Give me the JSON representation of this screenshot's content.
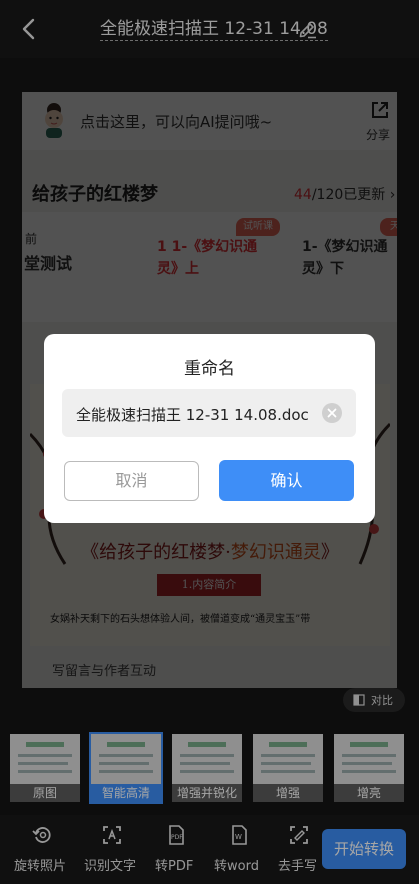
{
  "header": {
    "title": "全能极速扫描王 12-31 14.08"
  },
  "preview": {
    "ask_text": "点击这里，可以向AI提问哦~",
    "share_label": "分享",
    "course_title": "给孩子的红楼梦",
    "progress_current": "44",
    "progress_rest": "/120已更新",
    "lesson_prev_top": "前",
    "lesson_prev": "堂测试",
    "trial_badge": "试听课",
    "lesson_current": "1-《梦幻识通灵》上",
    "lesson_current_prefix": "1",
    "tag_next": "天",
    "lesson_next": "1-《梦幻识通灵》下",
    "poster_title_main": "《给孩子的红楼梦·",
    "poster_title_hl": "梦幻识通灵",
    "poster_title_end": "》",
    "section_label": "1.内容简介",
    "body_text": "女娲补天剩下的石头想体验人间，被僧道变成“通灵宝玉”带",
    "comment_text": "写留言与作者互动"
  },
  "compare": {
    "label": "对比"
  },
  "filters": [
    {
      "label": "原图",
      "selected": false
    },
    {
      "label": "智能高清",
      "selected": true
    },
    {
      "label": "增强并锐化",
      "selected": false
    },
    {
      "label": "增强",
      "selected": false
    },
    {
      "label": "增亮",
      "selected": false
    }
  ],
  "toolbar": {
    "rotate": "旋转照片",
    "ocr": "识别文字",
    "to_pdf": "转PDF",
    "to_word": "转word",
    "handwriting": "去手写",
    "start": "开始转换"
  },
  "dialog": {
    "title": "重命名",
    "input_value": "全能极速扫描王 12-31 14.08.doc",
    "cancel": "取消",
    "confirm": "确认"
  },
  "colors": {
    "accent": "#3e8ef7",
    "red": "#e6343a"
  }
}
